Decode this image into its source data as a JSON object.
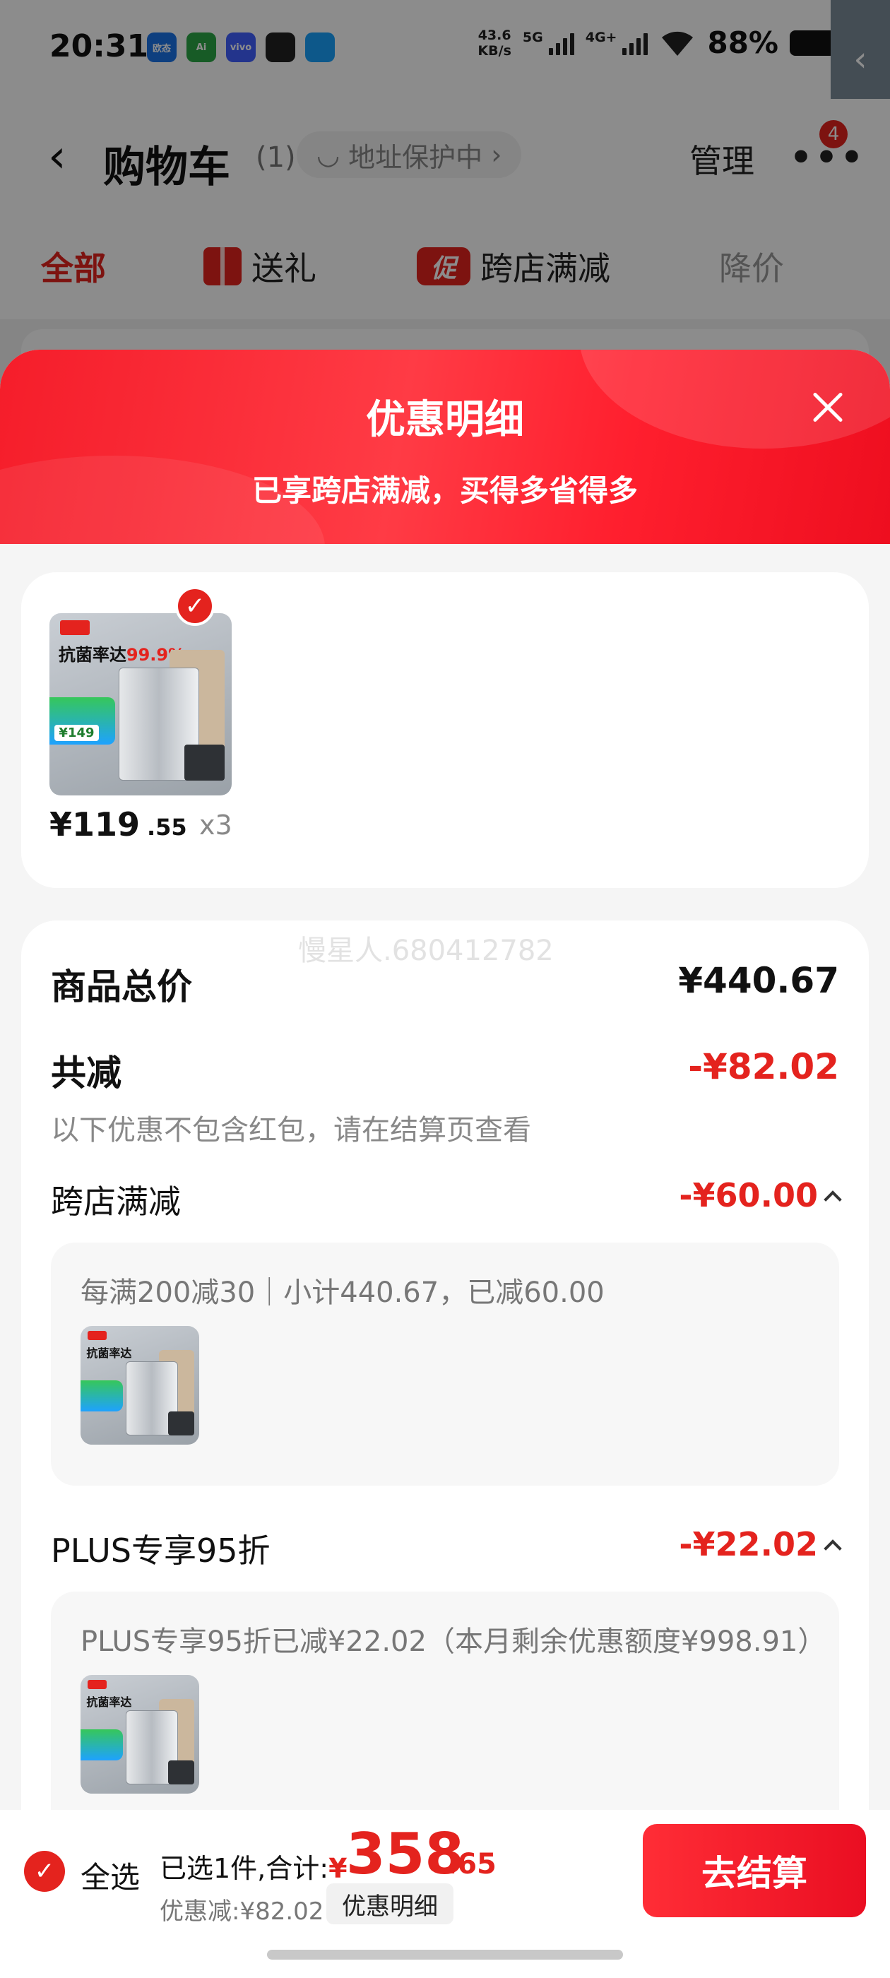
{
  "status_bar": {
    "time": "20:31",
    "apps": [
      {
        "label": "欧态",
        "color": "#1a73e8"
      },
      {
        "label": "Ai",
        "color": "#2aa745"
      },
      {
        "label": "vivo",
        "color": "#415fff"
      },
      {
        "label": "",
        "color": "#222222"
      },
      {
        "label": "",
        "color": "#18a0fb"
      }
    ],
    "net_speed_value": "43.6",
    "net_speed_unit": "KB/s",
    "sig1_label": "5G",
    "sig2_label": "4G+",
    "battery": "88%"
  },
  "nav": {
    "title": "购物车",
    "count": "(1)",
    "address_pill": "地址保护中",
    "manage": "管理",
    "more_badge": "4"
  },
  "filter_tabs": [
    {
      "label": "全部"
    },
    {
      "label": "送礼"
    },
    {
      "label": "跨店满减",
      "icon_text": "促"
    },
    {
      "label": "降价"
    }
  ],
  "sheet": {
    "title": "优惠明细",
    "subtitle": "已享跨店满减，买得多省得多"
  },
  "product": {
    "price_main": "¥119",
    "price_cents": ".55",
    "qty": "x3",
    "thumb_headline": "抗菌率达",
    "thumb_percent": "99.9%",
    "thumb_price": "¥149"
  },
  "details": {
    "watermark": "慢星人.680412782",
    "total_label": "商品总价",
    "total_value": "¥440.67",
    "reduce_label": "共减",
    "reduce_value": "-¥82.02",
    "reduce_note": "以下优惠不包含红包，请在结算页查看",
    "sections": [
      {
        "label": "跨店满减",
        "value": "-¥60.00",
        "detail": "每满200减30｜小计440.67，已减60.00"
      },
      {
        "label": "PLUS专享95折",
        "value": "-¥22.02",
        "detail": "PLUS专享95折已减¥22.02（本月剩余优惠额度¥998.91）"
      }
    ]
  },
  "bottom_bar": {
    "select_all": "全选",
    "selected_text": "已选1件,合计:",
    "currency": "¥",
    "total_main": "358",
    "total_cents": ".65",
    "discount_text": "优惠减:¥82.02",
    "detail_chip": "优惠明细",
    "checkout": "去结算"
  },
  "colors": {
    "brand_red": "#e4231e",
    "sheet_bg": "#f5f5f5"
  }
}
